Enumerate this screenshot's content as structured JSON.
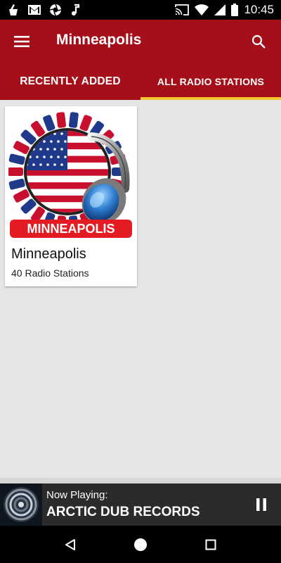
{
  "status_bar": {
    "time": "10:45",
    "icons": [
      "clean-icon",
      "gmail-icon",
      "shutter-icon",
      "music-note-icon",
      "cast-icon",
      "wifi-icon",
      "signal-icon",
      "battery-icon"
    ]
  },
  "app_bar": {
    "title": "Minneapolis",
    "menu_icon": "hamburger-menu-icon",
    "search_icon": "search-icon"
  },
  "tabs": [
    {
      "label": "RECENTLY ADDED",
      "selected": false
    },
    {
      "label": "ALL RADIO STATIONS",
      "selected": true
    }
  ],
  "cards": [
    {
      "title": "Minneapolis",
      "subtitle": "40 Radio Stations",
      "image": {
        "banner_text": "MINNEAPOLIS",
        "icon": "usa-flag-headphones-icon"
      }
    }
  ],
  "player": {
    "now_playing_label": "Now Playing:",
    "station": "ARCTIC DUB RECORDS",
    "control_icon": "pause-icon"
  },
  "colors": {
    "primary": "#a50f19",
    "tab_indicator": "#f4c430",
    "player_bg": "#2b2b2b",
    "background": "#e5e5e5"
  }
}
